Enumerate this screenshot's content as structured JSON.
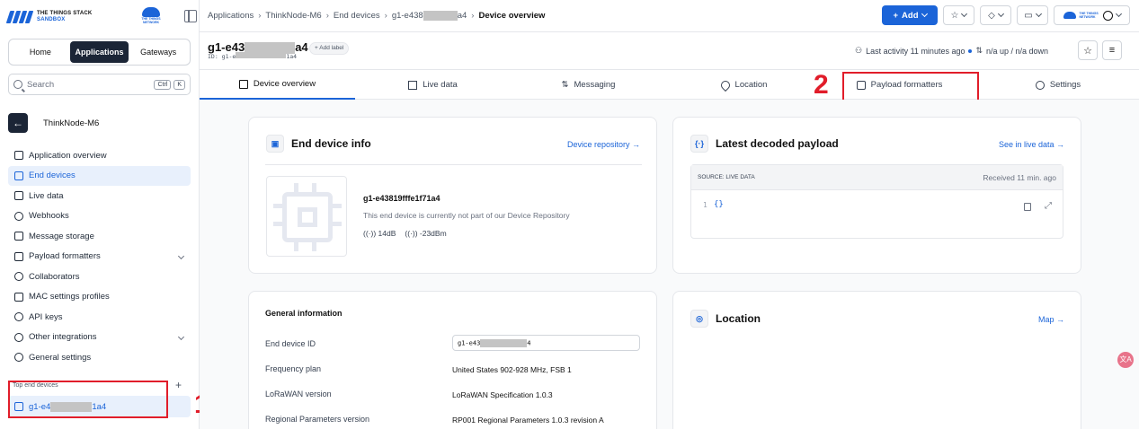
{
  "sidebar": {
    "logo_line1": "THE THINGS STACK",
    "logo_line2": "SANDBOX",
    "ttn_logo": "THE THINGS NETWORK",
    "nav_tabs": [
      "Home",
      "Applications",
      "Gateways"
    ],
    "search_placeholder": "Search",
    "search_kbd": [
      "Ctrl",
      "K"
    ],
    "app_name": "ThinkNode-M6",
    "menu": [
      {
        "label": "Application overview",
        "icon": "grid-icon"
      },
      {
        "label": "End devices",
        "icon": "chip-icon"
      },
      {
        "label": "Live data",
        "icon": "list-icon"
      },
      {
        "label": "Webhooks",
        "icon": "webhook-icon"
      },
      {
        "label": "Message storage",
        "icon": "database-icon"
      },
      {
        "label": "Payload formatters",
        "icon": "code-icon"
      },
      {
        "label": "Collaborators",
        "icon": "users-icon"
      },
      {
        "label": "MAC settings profiles",
        "icon": "settings-box-icon"
      },
      {
        "label": "API keys",
        "icon": "key-icon"
      },
      {
        "label": "Other integrations",
        "icon": "integrations-icon"
      },
      {
        "label": "General settings",
        "icon": "gear-icon"
      }
    ],
    "top_devices_label": "Top end devices",
    "top_device_prefix": "g1-e4",
    "top_device_suffix": "1a4"
  },
  "annotations": {
    "num1": "1",
    "num2": "2"
  },
  "header": {
    "breadcrumbs": [
      "Applications",
      "ThinkNode-M6",
      "End devices",
      "g1-e438",
      "a4",
      "Device overview"
    ],
    "add_label": "Add"
  },
  "device": {
    "title_prefix": "g1-e43",
    "title_suffix": "a4",
    "id_prefix": "ID: g1-e",
    "id_suffix": "1a4",
    "add_label": "Add label",
    "activity": "Last activity 11 minutes ago",
    "traffic": "n/a up / n/a down"
  },
  "tabs": [
    {
      "label": "Device overview",
      "icon": "overview-icon"
    },
    {
      "label": "Live data",
      "icon": "live-data-icon"
    },
    {
      "label": "Messaging",
      "icon": "messaging-icon"
    },
    {
      "label": "Location",
      "icon": "location-icon"
    },
    {
      "label": "Payload formatters",
      "icon": "payload-icon"
    },
    {
      "label": "Settings",
      "icon": "gear-icon"
    }
  ],
  "info_card": {
    "title": "End device info",
    "link": "Device repository →",
    "device_name": "g1-e43819fffe1f71a4",
    "note": "This end device is currently not part of our Device Repository",
    "rssi": "14dB",
    "snr": "-23dBm"
  },
  "payload_card": {
    "title": "Latest decoded payload",
    "link": "See in live data →",
    "source": "SOURCE: LIVE DATA",
    "received": "Received 11 min. ago",
    "line_no": "1",
    "code": "{}"
  },
  "general": {
    "title": "General information",
    "rows": [
      {
        "label": "End device ID",
        "value_prefix": "g1-e43",
        "value_suffix": "4"
      },
      {
        "label": "Frequency plan",
        "value": "United States 902-928 MHz, FSB 1"
      },
      {
        "label": "LoRaWAN version",
        "value": "LoRaWAN Specification 1.0.3"
      },
      {
        "label": "Regional Parameters version",
        "value": "RP001 Regional Parameters 1.0.3 revision A"
      }
    ]
  },
  "location_card": {
    "title": "Location",
    "link": "Map →"
  },
  "floating_badge": "文A"
}
